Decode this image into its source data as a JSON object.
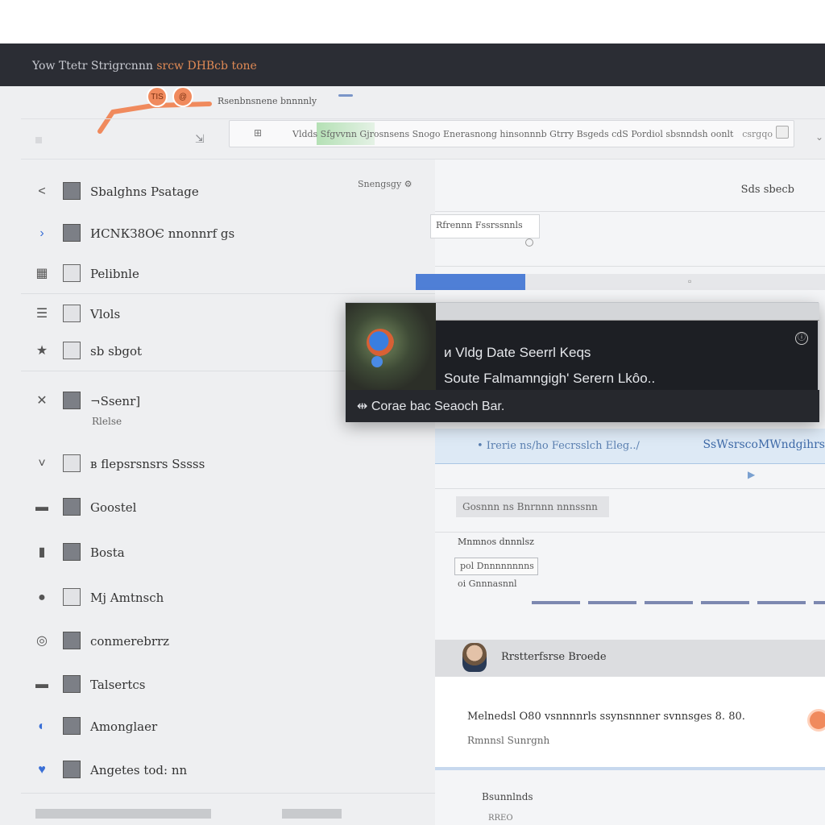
{
  "window": {
    "title_prefix": "Yow  Ttetr",
    "title_main": " Strigrcnnn ",
    "title_suffix": "srcw DHBcb tone"
  },
  "header": {
    "badge_1": "TIS",
    "badge_2": "@",
    "breadcrumb": "Rsenbnsnene bnnnnly"
  },
  "search": {
    "text": "Vldds  Sfgvvnn  Gjrosnsens Snogo Enerasnong hinsonnnb Gtrry Bsgeds cdS  Pordiol sbsnndsh oonlt",
    "end_text": "csrgqo"
  },
  "sidebar": {
    "items": [
      {
        "lead": "<",
        "label": "Sbalghns Psatage",
        "note": "Snengsgy  ⚙"
      },
      {
        "lead": "›",
        "label": "ИСNКЗ8ОЄ  nnonnrf gs"
      },
      {
        "lead": "▦",
        "label": "Pelibnle"
      },
      {
        "lead": "☰",
        "label": "Vlols"
      },
      {
        "lead": "★",
        "label": "sb sbgot"
      },
      {
        "lead": "✕",
        "label": "¬Ssenr]",
        "sub": "Rlelse"
      },
      {
        "lead": "˅",
        "label": "в flepsrsnsrs   Sssss"
      },
      {
        "lead": "▬",
        "label": "Goostel"
      },
      {
        "lead": "▮",
        "label": "Bosta"
      },
      {
        "lead": "●",
        "label": "Mj Amtnsch"
      },
      {
        "lead": "◎",
        "label": "conmerebrrz"
      },
      {
        "lead": "▬",
        "label": "Talsertcs"
      },
      {
        "lead": "◐",
        "label": "Amonglaer"
      },
      {
        "lead": "♥",
        "label": "Angetes  tod:  nn"
      }
    ]
  },
  "main": {
    "header_text": "Sds  sbecb",
    "card_text": "Rfrennn Fssrssnnls",
    "band_left": "• Irerie ns/ho Fecrsslch Eleg../",
    "band_right": "SsWsrscoMWndgihrs",
    "blur_text": "Gosnnn ns  Bnrnnn  nnnssnn",
    "section_label": "Mnmnos dnnnlsz",
    "chip_1": "pol Dnnnnnnnns",
    "chip_2": "oi Gnnnasnnl",
    "person_name": "Rrstterfsrse Broede",
    "detail_text": "Melnedsl  O80  vsnnnnrls  ssynsnnner  svnnsges  8.  80.",
    "detail_sub": "Rmnnsl  Sunrgnh",
    "footer_1": "Bsunnlnds",
    "footer_2": "RREO"
  },
  "tooltip": {
    "line_1": "и Vldg  Date  Seerrl  Keqs",
    "line_2": "Soute  Falmamngigh'   Serern  Lkôo..",
    "line_3": "⇹  Corae  bac  Seaoch  Bar."
  },
  "colors": {
    "accent_orange": "#f08a5d",
    "accent_blue": "#4f7fd6",
    "titlebar": "#2b2d34",
    "tooltip_bg": "#1d1f24"
  }
}
